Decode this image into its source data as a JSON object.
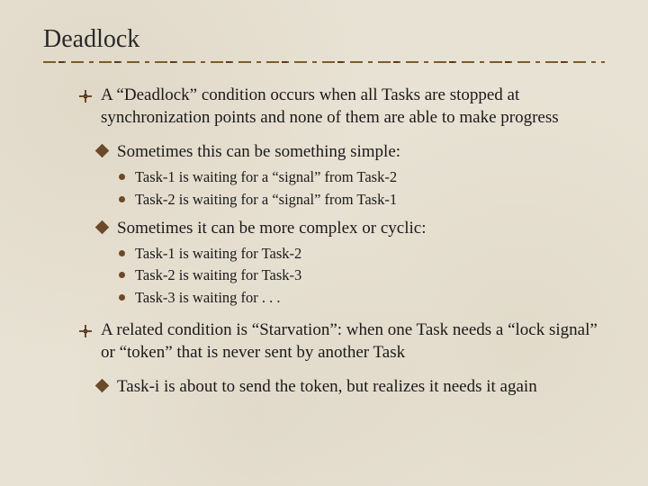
{
  "title": "Deadlock",
  "items": [
    {
      "text": "A “Deadlock” condition occurs when all Tasks are stopped at synchronization points and none of them are able to make progress",
      "subs": [
        {
          "text": "Sometimes this can be something simple:",
          "points": [
            "Task-1 is waiting for a “signal” from Task-2",
            "Task-2 is waiting for a “signal” from Task-1"
          ]
        },
        {
          "text": "Sometimes it can be more complex or cyclic:",
          "points": [
            "Task-1 is waiting for Task-2",
            "Task-2 is waiting for Task-3",
            "Task-3 is waiting for . . ."
          ]
        }
      ]
    },
    {
      "text": "A related condition is “Starvation”:  when one Task needs a “lock signal” or “token” that is never sent by another Task",
      "subs": [
        {
          "text": "Task-i is about to send the token, but realizes it needs it again",
          "points": []
        }
      ]
    }
  ]
}
